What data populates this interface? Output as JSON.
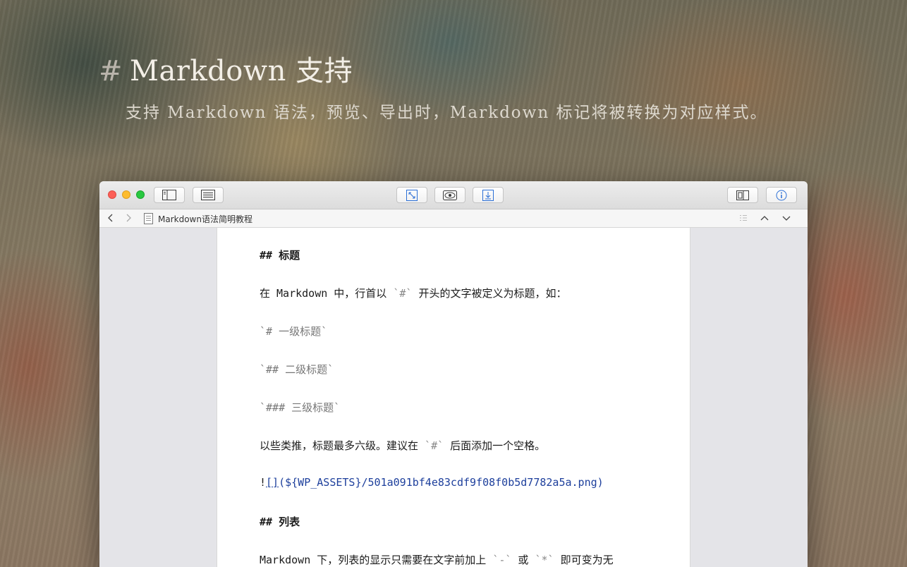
{
  "hero": {
    "hash": "#",
    "title": "Markdown 支持",
    "subtitle": "支持 Markdown 语法，预览、导出时，Markdown 标记将被转换为对应样式。"
  },
  "window": {
    "toolbar": {
      "buttons": [
        "sidebar-icon",
        "list-icon",
        "expand-icon",
        "preview-eye-icon",
        "export-download-icon",
        "split-view-icon",
        "info-icon"
      ]
    },
    "pathbar": {
      "document_title": "Markdown语法简明教程"
    }
  },
  "editor": {
    "lines": {
      "h_title": "## 标题",
      "p1_pre": "在 Markdown 中，行首以 ",
      "p1_code": "`#`",
      "p1_post": " 开头的文字被定义为标题，如：",
      "ex1": "`# 一级标题`",
      "ex2": "`## 二级标题`",
      "ex3": "`### 三级标题`",
      "p2_pre": "以些类推，标题最多六级。建议在 ",
      "p2_code": "`#`",
      "p2_post": " 后面添加一个空格。",
      "img_bang": "!",
      "img_brackets": "[]",
      "img_path": "(${WP_ASSETS}/501a091bf4e83cdf9f08f0b5d7782a5a.png)",
      "h_list": "## 列表",
      "p3_pre": "Markdown 下，列表的显示只需要在文字前加上 ",
      "p3_code1": "`-`",
      "p3_mid": " 或 ",
      "p3_code2": "`*`",
      "p3_post": " 即可变为无"
    }
  },
  "colors": {
    "link": "#1d3f9c",
    "traffic_red": "#fc5f57",
    "traffic_yellow": "#fdbc2e",
    "traffic_green": "#28c840"
  }
}
